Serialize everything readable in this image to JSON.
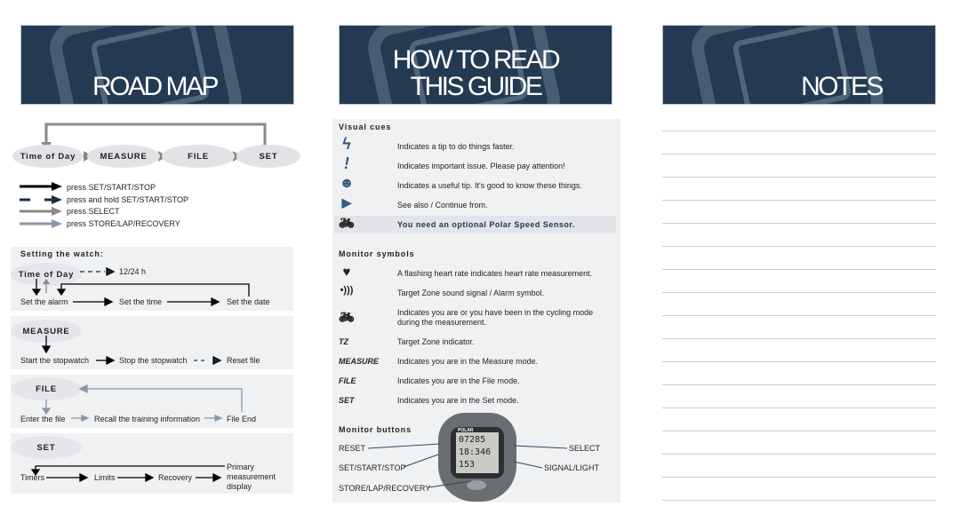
{
  "road_map": {
    "title": "ROAD MAP",
    "modes": [
      "Time of Day",
      "MEASURE",
      "FILE",
      "SET"
    ],
    "legend": [
      "press SET/START/STOP",
      "press and hold SET/START/STOP",
      "press SELECT",
      "press STORE/LAP/RECOVERY"
    ],
    "setting_heading": "Setting the watch:",
    "tod": {
      "label": "Time of Day",
      "hold": "12/24 h",
      "steps": [
        "Set the alarm",
        "Set the time",
        "Set the date"
      ]
    },
    "measure": {
      "label": "MEASURE",
      "steps": [
        "Start the stopwatch",
        "Stop the stopwatch",
        "Reset file"
      ]
    },
    "file": {
      "label": "FILE",
      "steps": [
        "Enter the file",
        "Recall the training information",
        "File End"
      ]
    },
    "set": {
      "label": "SET",
      "steps": [
        "Timers",
        "Limits",
        "Recovery",
        "Primary measurement display"
      ]
    }
  },
  "guide": {
    "title1": "HOW TO READ",
    "title2": "THIS GUIDE",
    "visual_cues_heading": "Visual cues",
    "visual_cues": [
      {
        "icon": "lightning-icon",
        "text": "Indicates a tip to do things faster."
      },
      {
        "icon": "exclamation-icon",
        "text": "Indicates important issue. Please pay attention!"
      },
      {
        "icon": "smiley-icon",
        "text": "Indicates a useful tip. It's good to know these things."
      },
      {
        "icon": "triangle-right-icon",
        "text": "See also / Continue from."
      },
      {
        "icon": "bicycle-icon",
        "text": "You need an optional Polar Speed Sensor."
      }
    ],
    "monitor_symbols_heading": "Monitor symbols",
    "monitor_symbols": [
      {
        "sym": "",
        "icon": "heart-icon",
        "text": "A flashing heart rate indicates heart rate measurement."
      },
      {
        "sym": "",
        "icon": "sound-signal-icon",
        "text": "Target Zone sound signal / Alarm symbol."
      },
      {
        "sym": "",
        "icon": "bicycle-icon",
        "text": "Indicates you are or you have been in the cycling mode during the measurement."
      },
      {
        "sym": "TZ",
        "text": "Target Zone indicator."
      },
      {
        "sym": "MEASURE",
        "text": "Indicates you are in the Measure mode."
      },
      {
        "sym": "FILE",
        "text": "Indicates you are in the File mode."
      },
      {
        "sym": "SET",
        "text": "Indicates you are in the Set mode."
      }
    ],
    "monitor_buttons_heading": "Monitor buttons",
    "buttons": {
      "reset": "RESET",
      "set_start_stop": "SET/START/STOP",
      "store": "STORE/LAP/RECOVERY",
      "select": "SELECT",
      "signal": "SIGNAL/LIGHT"
    },
    "watch": {
      "brand": "POLAR",
      "l1": "07285",
      "l2": "18:346",
      "l3": "153"
    }
  },
  "notes": {
    "title": "NOTES",
    "line_count": 17
  },
  "colors": {
    "banner": "#243a52",
    "icon_blue": "#2f5b87",
    "panel": "#f0f1f3",
    "pill": "#e1e3e6"
  }
}
